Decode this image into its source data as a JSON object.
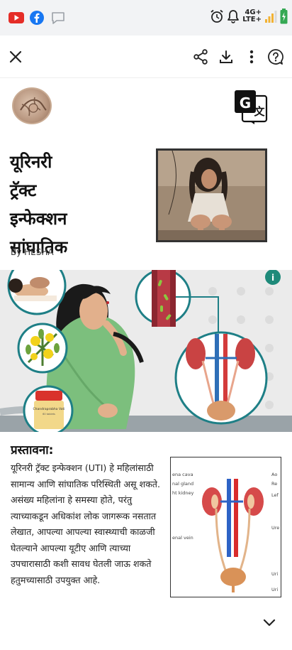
{
  "status_bar": {
    "apps": [
      "youtube-icon",
      "facebook-icon",
      "message-icon"
    ],
    "network_top": "4G+",
    "network_bottom": "LTE+",
    "icons": [
      "alarm-icon",
      "bell-icon",
      "signal-icon",
      "battery-icon"
    ]
  },
  "toolbar": {
    "icons": [
      "close-icon",
      "share-icon",
      "download-icon",
      "more-icon",
      "help-icon"
    ]
  },
  "article": {
    "title_lines": [
      "यूरिनरी",
      "ट्रॅक्ट",
      "इन्फेक्शन",
      "सांघातिक"
    ],
    "author": "By HESHA",
    "section_title": "प्रस्तावना:",
    "body_lines": [
      "यूरिनरी ट्रॅक्ट इन्फेक्शन (UTI) हे महिलांसाठी",
      "सामान्य आणि सांघातिक परिस्थिती असू शकते.",
      "असंख्य महिलांना हे समस्या होते, परंतु",
      "त्याच्याकडून अधिकांश लोक जागरूक नसतात",
      "लेखात, आपल्या आपल्या स्वास्थ्याची काळजी",
      "घेतल्याने आपल्या यूटीए आणि त्याच्या",
      "उपचारासाठी कशी सावध घेतली जाऊ शकते",
      "हतुमच्यासाठी उपयुक्त आहे."
    ]
  },
  "hero": {
    "bottle_label": "Chandraprabha Vati",
    "bottle_sub": "60 tablets"
  },
  "diagram": {
    "left_labels": [
      "ena cava",
      "nal gland",
      "ht kidney",
      "enal vein"
    ],
    "right_labels": [
      "Ao",
      "Re",
      "Lef",
      "Ure",
      "Uri",
      "Uri"
    ]
  },
  "colors": {
    "accent_teal": "#1e7f86",
    "youtube_red": "#e52d27",
    "facebook_blue": "#1877f2",
    "battery_green": "#34a853"
  }
}
